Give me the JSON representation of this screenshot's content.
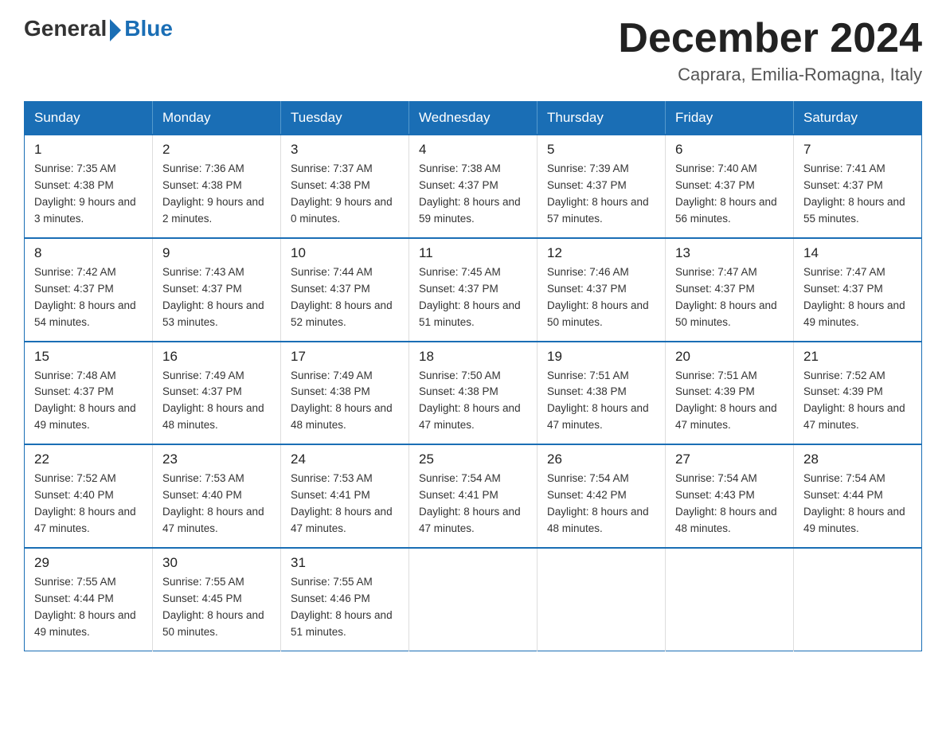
{
  "logo": {
    "general": "General",
    "blue": "Blue"
  },
  "title": "December 2024",
  "location": "Caprara, Emilia-Romagna, Italy",
  "days_of_week": [
    "Sunday",
    "Monday",
    "Tuesday",
    "Wednesday",
    "Thursday",
    "Friday",
    "Saturday"
  ],
  "weeks": [
    [
      {
        "day": "1",
        "sunrise": "7:35 AM",
        "sunset": "4:38 PM",
        "daylight": "9 hours and 3 minutes."
      },
      {
        "day": "2",
        "sunrise": "7:36 AM",
        "sunset": "4:38 PM",
        "daylight": "9 hours and 2 minutes."
      },
      {
        "day": "3",
        "sunrise": "7:37 AM",
        "sunset": "4:38 PM",
        "daylight": "9 hours and 0 minutes."
      },
      {
        "day": "4",
        "sunrise": "7:38 AM",
        "sunset": "4:37 PM",
        "daylight": "8 hours and 59 minutes."
      },
      {
        "day": "5",
        "sunrise": "7:39 AM",
        "sunset": "4:37 PM",
        "daylight": "8 hours and 57 minutes."
      },
      {
        "day": "6",
        "sunrise": "7:40 AM",
        "sunset": "4:37 PM",
        "daylight": "8 hours and 56 minutes."
      },
      {
        "day": "7",
        "sunrise": "7:41 AM",
        "sunset": "4:37 PM",
        "daylight": "8 hours and 55 minutes."
      }
    ],
    [
      {
        "day": "8",
        "sunrise": "7:42 AM",
        "sunset": "4:37 PM",
        "daylight": "8 hours and 54 minutes."
      },
      {
        "day": "9",
        "sunrise": "7:43 AM",
        "sunset": "4:37 PM",
        "daylight": "8 hours and 53 minutes."
      },
      {
        "day": "10",
        "sunrise": "7:44 AM",
        "sunset": "4:37 PM",
        "daylight": "8 hours and 52 minutes."
      },
      {
        "day": "11",
        "sunrise": "7:45 AM",
        "sunset": "4:37 PM",
        "daylight": "8 hours and 51 minutes."
      },
      {
        "day": "12",
        "sunrise": "7:46 AM",
        "sunset": "4:37 PM",
        "daylight": "8 hours and 50 minutes."
      },
      {
        "day": "13",
        "sunrise": "7:47 AM",
        "sunset": "4:37 PM",
        "daylight": "8 hours and 50 minutes."
      },
      {
        "day": "14",
        "sunrise": "7:47 AM",
        "sunset": "4:37 PM",
        "daylight": "8 hours and 49 minutes."
      }
    ],
    [
      {
        "day": "15",
        "sunrise": "7:48 AM",
        "sunset": "4:37 PM",
        "daylight": "8 hours and 49 minutes."
      },
      {
        "day": "16",
        "sunrise": "7:49 AM",
        "sunset": "4:37 PM",
        "daylight": "8 hours and 48 minutes."
      },
      {
        "day": "17",
        "sunrise": "7:49 AM",
        "sunset": "4:38 PM",
        "daylight": "8 hours and 48 minutes."
      },
      {
        "day": "18",
        "sunrise": "7:50 AM",
        "sunset": "4:38 PM",
        "daylight": "8 hours and 47 minutes."
      },
      {
        "day": "19",
        "sunrise": "7:51 AM",
        "sunset": "4:38 PM",
        "daylight": "8 hours and 47 minutes."
      },
      {
        "day": "20",
        "sunrise": "7:51 AM",
        "sunset": "4:39 PM",
        "daylight": "8 hours and 47 minutes."
      },
      {
        "day": "21",
        "sunrise": "7:52 AM",
        "sunset": "4:39 PM",
        "daylight": "8 hours and 47 minutes."
      }
    ],
    [
      {
        "day": "22",
        "sunrise": "7:52 AM",
        "sunset": "4:40 PM",
        "daylight": "8 hours and 47 minutes."
      },
      {
        "day": "23",
        "sunrise": "7:53 AM",
        "sunset": "4:40 PM",
        "daylight": "8 hours and 47 minutes."
      },
      {
        "day": "24",
        "sunrise": "7:53 AM",
        "sunset": "4:41 PM",
        "daylight": "8 hours and 47 minutes."
      },
      {
        "day": "25",
        "sunrise": "7:54 AM",
        "sunset": "4:41 PM",
        "daylight": "8 hours and 47 minutes."
      },
      {
        "day": "26",
        "sunrise": "7:54 AM",
        "sunset": "4:42 PM",
        "daylight": "8 hours and 48 minutes."
      },
      {
        "day": "27",
        "sunrise": "7:54 AM",
        "sunset": "4:43 PM",
        "daylight": "8 hours and 48 minutes."
      },
      {
        "day": "28",
        "sunrise": "7:54 AM",
        "sunset": "4:44 PM",
        "daylight": "8 hours and 49 minutes."
      }
    ],
    [
      {
        "day": "29",
        "sunrise": "7:55 AM",
        "sunset": "4:44 PM",
        "daylight": "8 hours and 49 minutes."
      },
      {
        "day": "30",
        "sunrise": "7:55 AM",
        "sunset": "4:45 PM",
        "daylight": "8 hours and 50 minutes."
      },
      {
        "day": "31",
        "sunrise": "7:55 AM",
        "sunset": "4:46 PM",
        "daylight": "8 hours and 51 minutes."
      },
      null,
      null,
      null,
      null
    ]
  ]
}
